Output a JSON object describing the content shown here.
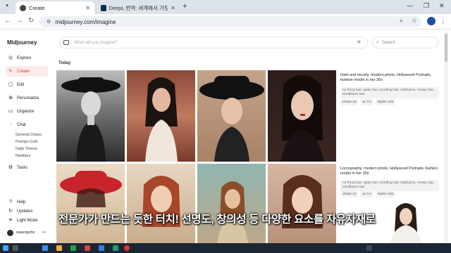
{
  "browser": {
    "tabs": [
      {
        "label": "Create",
        "active": true
      },
      {
        "label": "DeepL 번역: 세계에서 가장 정...",
        "active": false
      }
    ],
    "new_tab_label": "+",
    "url": "midjourney.com/imagine"
  },
  "sidebar": {
    "brand": "Midjourney",
    "items": [
      {
        "label": "Explore",
        "icon": "compass-icon"
      },
      {
        "label": "Create",
        "icon": "create-icon",
        "active": true
      },
      {
        "label": "Edit",
        "icon": "edit-icon"
      },
      {
        "label": "Personalize",
        "icon": "personalize-icon"
      },
      {
        "label": "Organize",
        "icon": "folder-icon"
      },
      {
        "label": "Chat",
        "icon": "chat-icon"
      }
    ],
    "chat_rooms": [
      "General Chaos",
      "Prompt Craft",
      "Daily Theme",
      "Newbies"
    ],
    "tasks_label": "Tasks",
    "bottom": [
      {
        "label": "Help",
        "icon": "help-icon"
      },
      {
        "label": "Updates",
        "icon": "updates-icon"
      },
      {
        "label": "Light Mode",
        "icon": "sun-icon"
      }
    ],
    "user": "ssaengcho"
  },
  "prompt_bar": {
    "placeholder": "What will you imagine?"
  },
  "search": {
    "placeholder": "Search"
  },
  "feed": {
    "section_label": "Today",
    "jobs": [
      {
        "prompt": "Dark and moody, modern photo, Hollywood Portraits, fashion model in her 30s",
        "params": "no frizzy hair, spiky hair, receding hair, sideburns, messy hair, windblown hair",
        "chips": [
          "chaos 10",
          "ar 3:4",
          "stylize 300"
        ]
      },
      {
        "prompt": "Lomography, modern photo, Hollywood Portraits, fashion model in her 30s",
        "params": "no frizzy hair, spiky hair, receding hair, sideburns, messy hair, windblown hair",
        "chips": [
          "chaos 10",
          "ar 3:4",
          "stylize 300"
        ]
      }
    ]
  },
  "caption": "전문가가 만드는 듯한 터치! 선명도, 창의성 등 다양한 요소를 자유자재로",
  "colors": {
    "accent": "#e0362c",
    "active_bg": "#fdecec",
    "taskbar": "#1c2533"
  }
}
